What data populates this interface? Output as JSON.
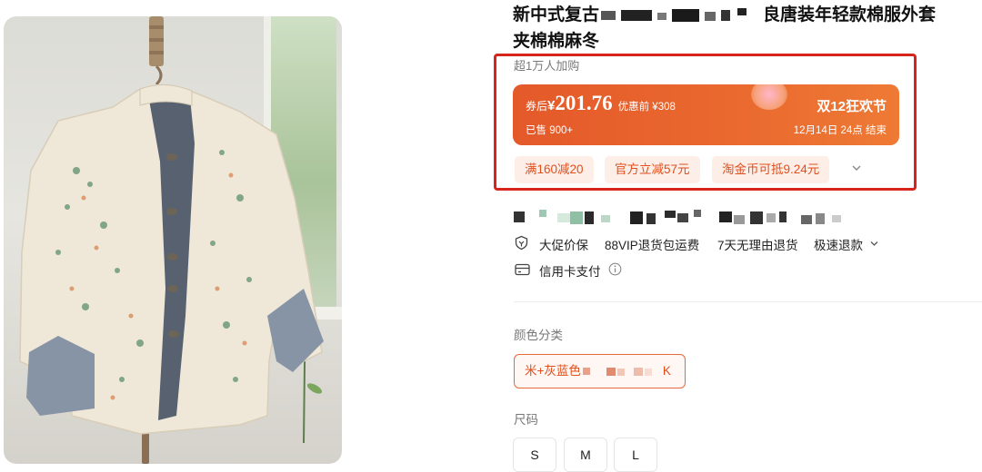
{
  "product": {
    "title_start": "新中式复古",
    "title_end": "良唐装年轻款棉服外套",
    "title_line2": "夹棉棉麻冬",
    "buyers": "超1万人加购"
  },
  "price_card": {
    "after_label": "券后",
    "currency": "¥",
    "price": "201.76",
    "original": "优惠前 ¥308",
    "sold": "已售 900+",
    "event": "双12狂欢节",
    "deadline": "12月14日 24点 结束"
  },
  "coupons": [
    "满160减20",
    "官方立减57元",
    "淘金币可抵9.24元"
  ],
  "services": {
    "price_protect": "大促价保",
    "vip_return": "88VIP退货包运费",
    "seven_day": "7天无理由退货",
    "fast_refund": "极速退款",
    "credit_card": "信用卡支付"
  },
  "color_section": {
    "label": "颜色分类",
    "selected_prefix": "米+灰蓝色",
    "selected_suffix": "K"
  },
  "size_section": {
    "label": "尺码",
    "options": [
      "S",
      "M",
      "L"
    ]
  },
  "colors": {
    "accent": "#e4592a",
    "highlight_box": "#d8251c",
    "coupon_bg": "#fdeee7"
  }
}
